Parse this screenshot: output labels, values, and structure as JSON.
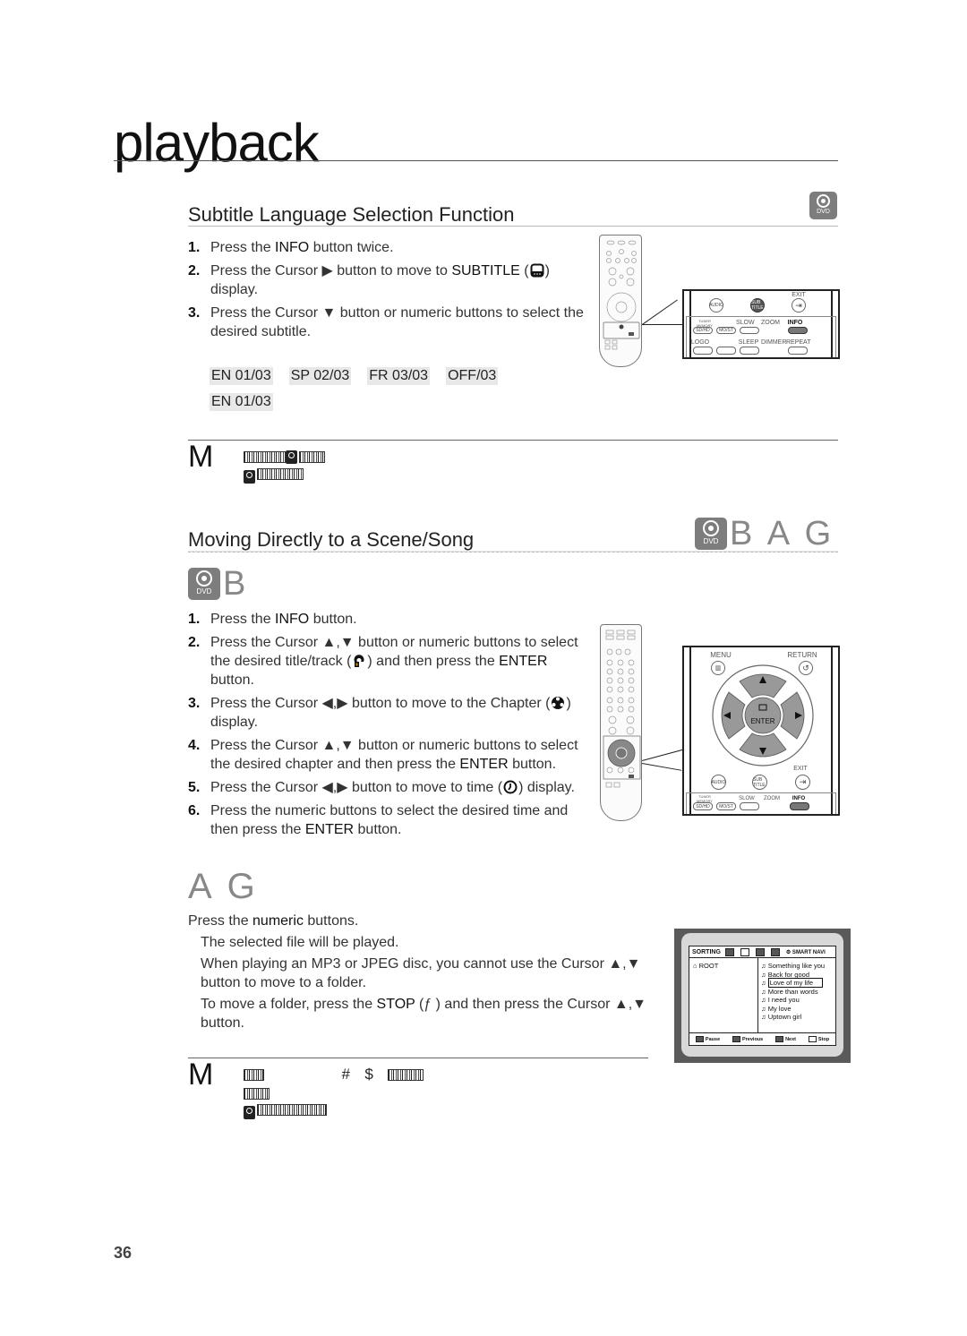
{
  "page": {
    "title": "playback",
    "page_number": "36"
  },
  "section1": {
    "heading": "Subtitle Language Selection Function",
    "badge": "DVD",
    "steps": [
      {
        "num": "1.",
        "parts": [
          "Press the ",
          "INFO",
          " button twice."
        ]
      },
      {
        "num": "2.",
        "parts": [
          "Press the Cursor ▶ button to move to ",
          "SUBTITLE",
          " (",
          ") display."
        ]
      },
      {
        "num": "3.",
        "parts": [
          "Press the Cursor ▼ button or numeric buttons to select the desired subtitle."
        ]
      }
    ],
    "subtitle_options": [
      "EN 01/03",
      "SP 02/03",
      "FR 03/03",
      "OFF/03"
    ],
    "subtitle_current": "EN 01/03",
    "note": {
      "marker": "M"
    },
    "remote": {
      "exit_label": "EXIT",
      "audio_label": "AUDIO",
      "subtitle_label": "SUB TITLE",
      "row1": [
        "TUNER MEMORY",
        "SLOW",
        "ZOOM",
        "INFO"
      ],
      "row1_btn": [
        "SD/HD",
        "MO/ST",
        "",
        ""
      ],
      "row2": [
        "LOGO",
        "SLEEP",
        "DIMMER",
        "REPEAT"
      ]
    }
  },
  "section2": {
    "heading": "Moving Directly to a Scene/Song",
    "badge": "DVD",
    "header_glyphs": "B A G",
    "sub_glyph": "B",
    "steps": [
      {
        "num": "1.",
        "parts": [
          "Press the ",
          "INFO",
          " button."
        ]
      },
      {
        "num": "2.",
        "parts": [
          "Press the Cursor ▲,▼ button or numeric buttons to select the desired title/track (",
          ")  and then press the ",
          "ENTER",
          " button."
        ]
      },
      {
        "num": "3.",
        "parts": [
          "Press the Cursor ◀,▶ button to move to the Chapter (",
          ") display."
        ]
      },
      {
        "num": "4.",
        "parts": [
          "Press the Cursor ▲,▼ button or numeric buttons to select the desired chapter and then press the ",
          "ENTER",
          " button."
        ]
      },
      {
        "num": "5.",
        "parts": [
          "Press the Cursor ◀,▶ button to move to time (",
          ") display."
        ]
      },
      {
        "num": "6.",
        "parts": [
          "Press the numeric buttons to select the desired time and then press the ",
          "ENTER",
          " button."
        ]
      }
    ],
    "remote": {
      "menu_label": "MENU",
      "return_label": "RETURN",
      "enter_label": "ENTER",
      "exit_label": "EXIT",
      "audio_label": "AUDIO",
      "subtitle_label": "SUB TITLE",
      "row1": [
        "TUNER MEMORY",
        "SLOW",
        "ZOOM",
        "INFO"
      ],
      "row1_btn": [
        "SD/HD",
        "MO/ST",
        "",
        ""
      ]
    }
  },
  "section3": {
    "heading_glyphs": "A G",
    "intro": [
      "Press the ",
      "numeric",
      " buttons."
    ],
    "bullets": [
      "The selected file will be played.",
      "When playing an MP3 or JPEG disc, you cannot use the Cursor ▲,▼ button to move to a folder.",
      [
        "To move a folder, press the ",
        "STOP",
        " (ƒ   ) and then press the Cursor ▲,▼ button."
      ]
    ],
    "note": {
      "marker": "M",
      "symbols": [
        "#",
        "$"
      ]
    },
    "screen": {
      "sorting_label": "SORTING",
      "smart_navi_label": "⚙ SMART NAVI",
      "folder": "ROOT",
      "tracks": [
        "Something like you",
        "Back for good",
        "Love of my life",
        "More than words",
        "I need you",
        "My love",
        "Uptown girl"
      ],
      "selected_track": "Love of my life",
      "footer": [
        "Pause",
        "Previous",
        "Next",
        "Stop"
      ]
    }
  }
}
